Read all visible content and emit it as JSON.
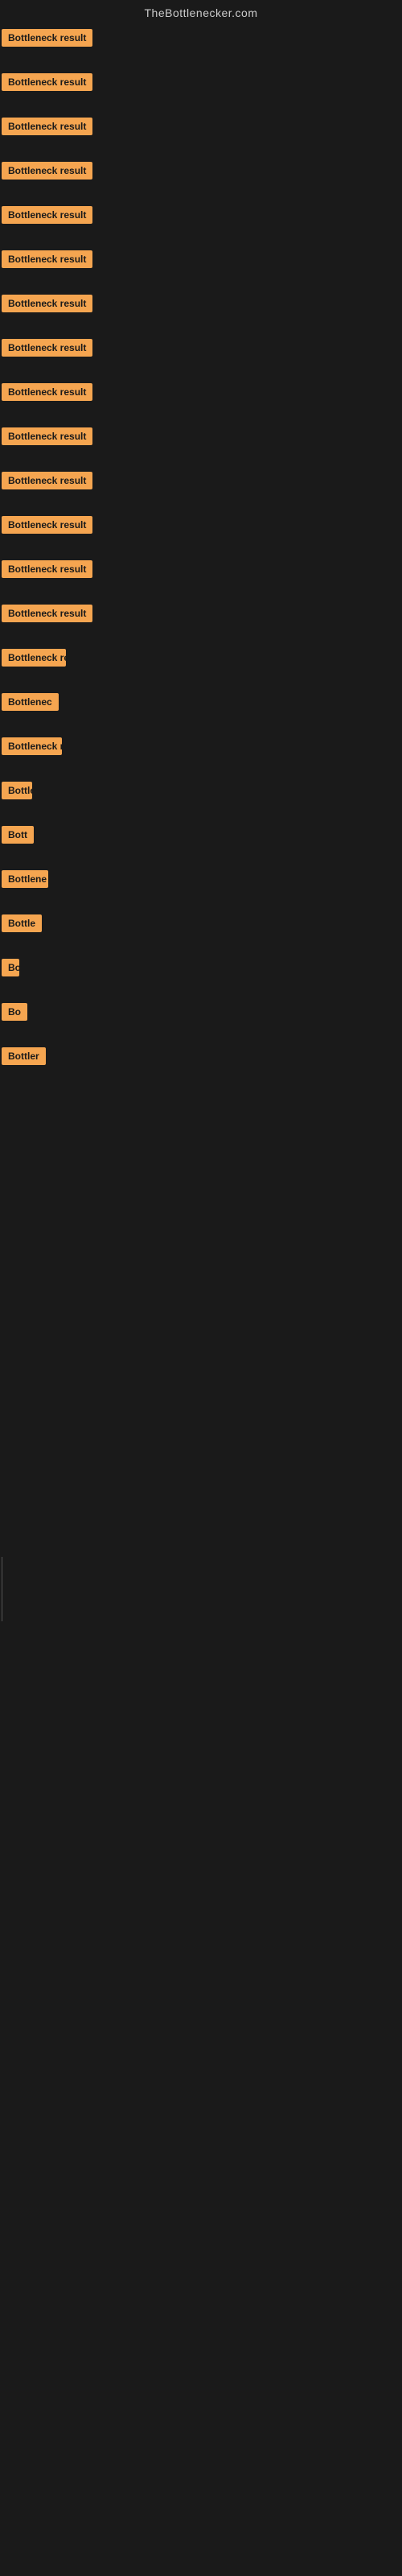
{
  "site": {
    "title": "TheBottlenecker.com"
  },
  "items": [
    {
      "id": "item-1",
      "label": "Bottleneck result",
      "class": "item-1"
    },
    {
      "id": "item-2",
      "label": "Bottleneck result",
      "class": "item-2"
    },
    {
      "id": "item-3",
      "label": "Bottleneck result",
      "class": "item-3"
    },
    {
      "id": "item-4",
      "label": "Bottleneck result",
      "class": "item-4"
    },
    {
      "id": "item-5",
      "label": "Bottleneck result",
      "class": "item-5"
    },
    {
      "id": "item-6",
      "label": "Bottleneck result",
      "class": "item-6"
    },
    {
      "id": "item-7",
      "label": "Bottleneck result",
      "class": "item-7"
    },
    {
      "id": "item-8",
      "label": "Bottleneck result",
      "class": "item-8"
    },
    {
      "id": "item-9",
      "label": "Bottleneck result",
      "class": "item-9"
    },
    {
      "id": "item-10",
      "label": "Bottleneck result",
      "class": "item-10"
    },
    {
      "id": "item-11",
      "label": "Bottleneck result",
      "class": "item-11"
    },
    {
      "id": "item-12",
      "label": "Bottleneck result",
      "class": "item-12"
    },
    {
      "id": "item-13",
      "label": "Bottleneck result",
      "class": "item-13"
    },
    {
      "id": "item-14",
      "label": "Bottleneck result",
      "class": "item-14"
    },
    {
      "id": "item-15",
      "label": "Bottleneck re",
      "class": "item-15"
    },
    {
      "id": "item-16",
      "label": "Bottlenec",
      "class": "item-16"
    },
    {
      "id": "item-17",
      "label": "Bottleneck r",
      "class": "item-17"
    },
    {
      "id": "item-18",
      "label": "Bottlen",
      "class": "item-18"
    },
    {
      "id": "item-19",
      "label": "Bott",
      "class": "item-19"
    },
    {
      "id": "item-20",
      "label": "Bottlene",
      "class": "item-20"
    },
    {
      "id": "item-21",
      "label": "Bottle",
      "class": "item-21"
    },
    {
      "id": "item-22",
      "label": "Bottlenec",
      "class": "item-22"
    },
    {
      "id": "item-23",
      "label": "Bo",
      "class": "item-23"
    },
    {
      "id": "item-24",
      "label": "Bottler",
      "class": "item-24"
    }
  ]
}
